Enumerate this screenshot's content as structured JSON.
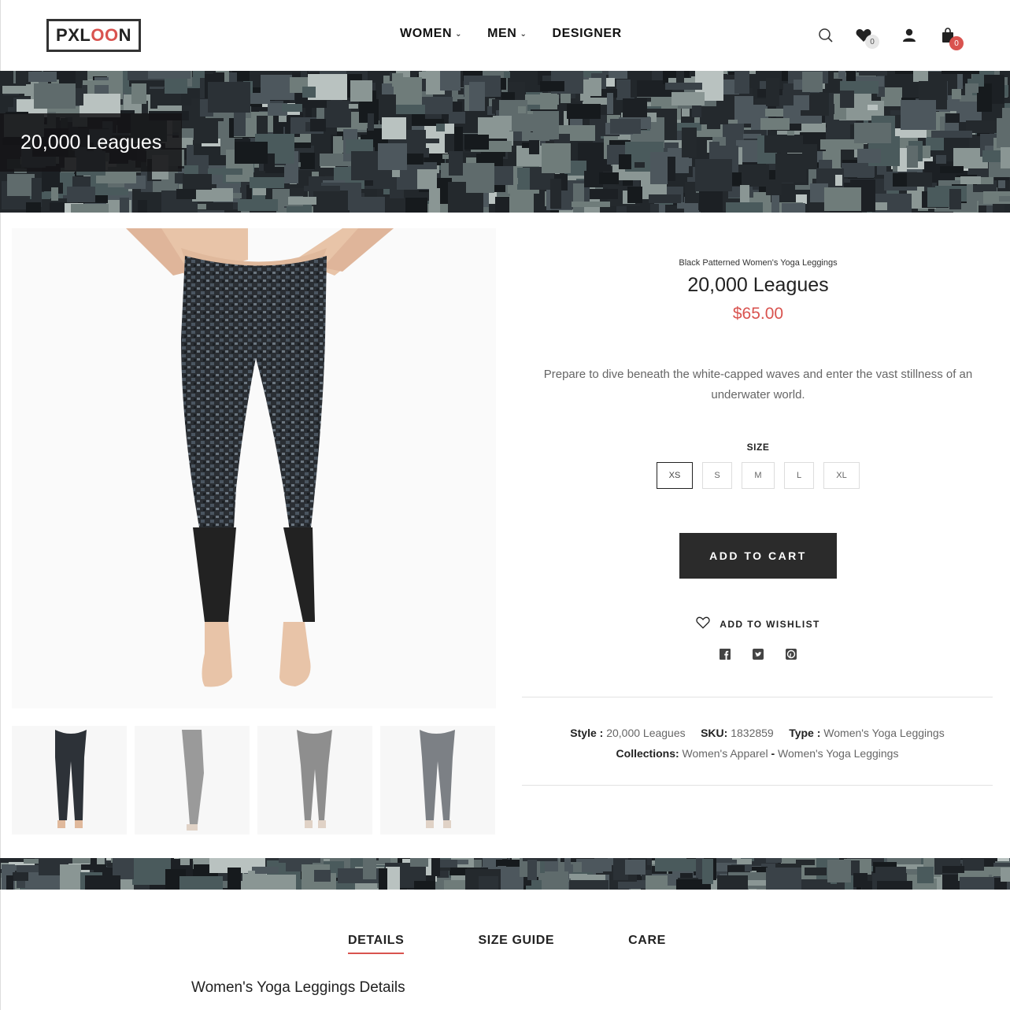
{
  "header": {
    "logo_prefix": "PXL",
    "logo_oo": "OO",
    "logo_suffix": "N",
    "nav": [
      {
        "label": "WOMEN",
        "has_dropdown": true
      },
      {
        "label": "MEN",
        "has_dropdown": true
      },
      {
        "label": "DESIGNER",
        "has_dropdown": false
      }
    ],
    "icons": [
      "search-icon",
      "heart-icon",
      "user-icon",
      "bag-icon"
    ],
    "wishlist_count": "0",
    "cart_count": "0"
  },
  "banner": {
    "title": "20,000 Leagues"
  },
  "product": {
    "subtitle": "Black Patterned Women's Yoga Leggings",
    "title": "20,000 Leagues",
    "price": "$65.00",
    "description": "Prepare to dive beneath the white-capped waves and enter the vast stillness of an underwater world.",
    "size_label": "SIZE",
    "sizes": [
      "XS",
      "S",
      "M",
      "L",
      "XL"
    ],
    "selected_size": "XS",
    "add_to_cart": "ADD TO CART",
    "add_to_wishlist": "ADD TO WISHLIST",
    "social": [
      "facebook-icon",
      "twitter-icon",
      "pinterest-icon"
    ]
  },
  "meta": {
    "style_label": "Style :",
    "style_value": "20,000 Leagues",
    "sku_label": "SKU:",
    "sku_value": "1832859",
    "type_label": "Type :",
    "type_value": "Women's Yoga Leggings",
    "collections_label": "Collections:",
    "collections_value1": "Women's Apparel",
    "collections_sep": "-",
    "collections_value2": "Women's Yoga Leggings"
  },
  "tabs": [
    {
      "label": "DETAILS",
      "active": true
    },
    {
      "label": "SIZE GUIDE",
      "active": false
    },
    {
      "label": "CARE",
      "active": false
    }
  ],
  "details_heading": "Women's Yoga Leggings Details",
  "colors": {
    "accent": "#d9534f",
    "dark_button": "#2b2b2b"
  }
}
